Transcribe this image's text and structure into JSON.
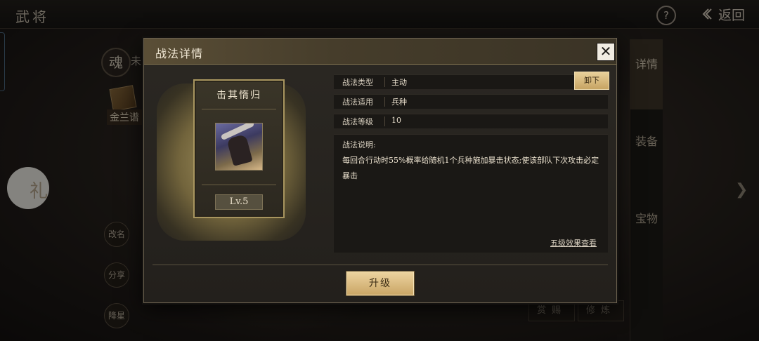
{
  "topbar": {
    "title": "武将",
    "help_label": "?",
    "back_label": "返回",
    "back_icon": "back-arrow-icon"
  },
  "background": {
    "soul_badge": "魂",
    "soul_label": "未",
    "jinlan_label": "金兰谱",
    "side_circle_glyph": "礼",
    "round_buttons": [
      "改名",
      "分享",
      "降星"
    ],
    "right_tabs": [
      "详情",
      "装备",
      "宝物"
    ],
    "bottom_buttons": [
      "赏赐",
      "修炼"
    ]
  },
  "modal": {
    "title": "战法详情",
    "close_label": "✕",
    "skill": {
      "name": "击其惰归",
      "level": "Lv.5",
      "icon": "skill-warrior-icon"
    },
    "rows": [
      {
        "label": "战法类型",
        "value": "主动"
      },
      {
        "label": "战法适用",
        "value": "兵种"
      },
      {
        "label": "战法等级",
        "value": "10"
      }
    ],
    "unload_label": "卸下",
    "desc_title": "战法说明:",
    "desc_text": "每回合行动时55%概率给随机1个兵种施加暴击状态;使该部队下次攻击必定暴击",
    "five_link": "五级效果查看",
    "upgrade_label": "升级"
  },
  "colors": {
    "accent_gold": "#c7a463",
    "panel_bg": "#23201c",
    "border_gold": "#a8955f"
  }
}
